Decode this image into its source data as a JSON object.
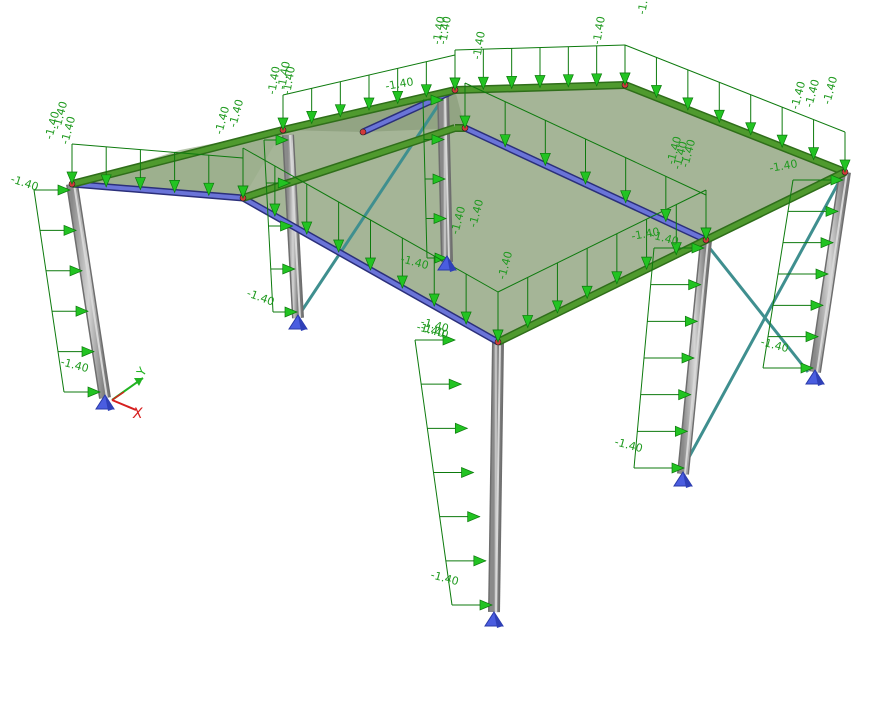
{
  "viewport": {
    "background": "#ffffff",
    "colors": {
      "load": "#22c322",
      "load_outline": "#0d7a0d",
      "load_text": "#1f9a1f",
      "column": "#a9a9a9",
      "column_dark": "#6e6e6e",
      "roof_surface": "#8fa37d",
      "beam": "#4f9a2e",
      "rafter": "#6a74d8",
      "bracing": "#3f8f8f",
      "support": "#4a5de0",
      "axis_x": "#d61f1f",
      "axis_y": "#22b322"
    },
    "load_value": "-1.40",
    "load_labels": [
      "-1.40",
      "-1.40",
      "-1.40",
      "-1.40",
      "-1.40",
      "-1.40",
      "-1.40",
      "-1.40",
      "-1.40",
      "-1.40",
      "-1.40",
      "-1.40",
      "-1.40",
      "-1.40",
      "-1.40",
      "-1.40",
      "-1.40",
      "-1.40",
      "-1.40",
      "-1.40",
      "-1.40",
      "-1.40",
      "-1.40",
      "-1.40",
      "-1.40",
      "-1.40",
      "-1.40",
      "-1.40",
      "-1.40",
      "-1.40"
    ],
    "axis": {
      "x_label": "X",
      "y_label": "Y"
    },
    "icons": [
      "coordinate-axis-icon",
      "support-icon"
    ]
  }
}
